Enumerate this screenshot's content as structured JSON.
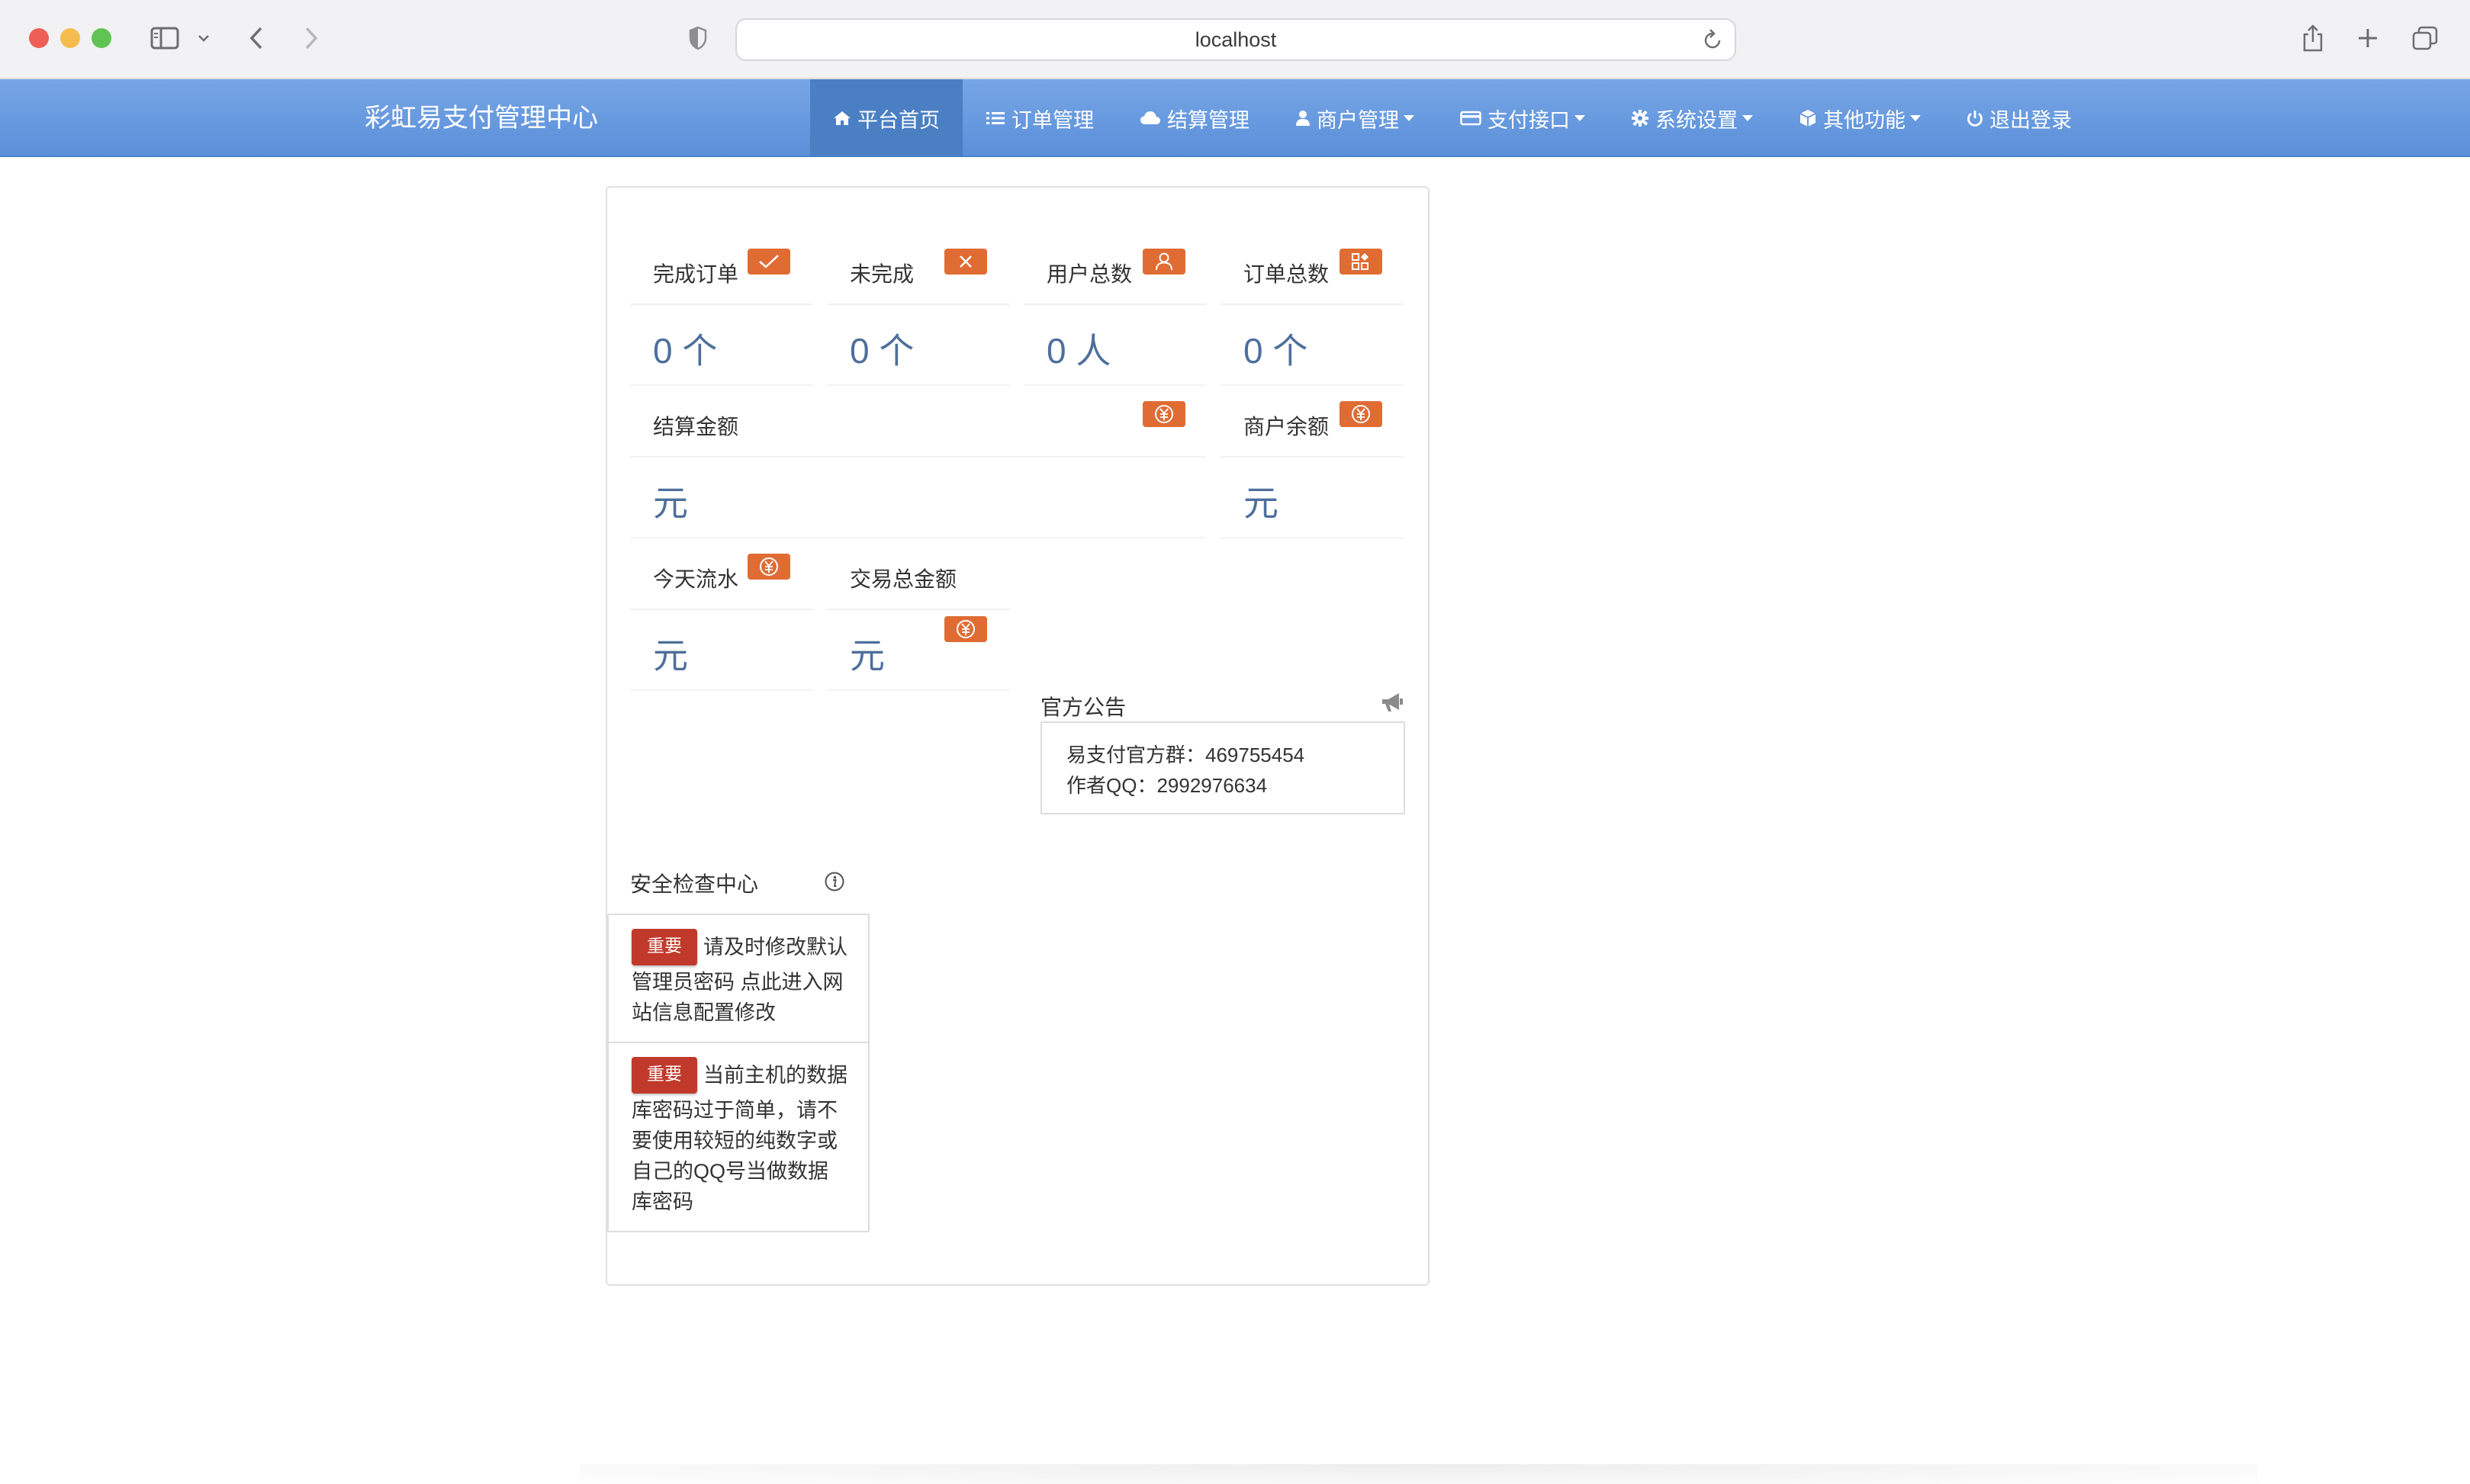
{
  "browser": {
    "url": "localhost"
  },
  "navbar": {
    "brand": "彩虹易支付管理中心",
    "items": [
      {
        "label": "平台首页",
        "icon": "home-icon",
        "dropdown": false,
        "active": true
      },
      {
        "label": "订单管理",
        "icon": "list-icon",
        "dropdown": false,
        "active": false
      },
      {
        "label": "结算管理",
        "icon": "cloud-icon",
        "dropdown": false,
        "active": false
      },
      {
        "label": "商户管理",
        "icon": "user-icon",
        "dropdown": true,
        "active": false
      },
      {
        "label": "支付接口",
        "icon": "credit-card-icon",
        "dropdown": true,
        "active": false
      },
      {
        "label": "系统设置",
        "icon": "gear-icon",
        "dropdown": true,
        "active": false
      },
      {
        "label": "其他功能",
        "icon": "cube-icon",
        "dropdown": true,
        "active": false
      },
      {
        "label": "退出登录",
        "icon": "power-icon",
        "dropdown": false,
        "active": false
      }
    ]
  },
  "stats": {
    "completed_orders": {
      "label": "完成订单",
      "value": "0 个",
      "icon": "check-icon"
    },
    "uncompleted": {
      "label": "未完成",
      "value": "0 个",
      "icon": "close-icon"
    },
    "total_users": {
      "label": "用户总数",
      "value": "0 人",
      "icon": "user-icon"
    },
    "total_orders": {
      "label": "订单总数",
      "value": "0 个",
      "icon": "apps-icon"
    },
    "settlement_amount": {
      "label": "结算金额",
      "value": "元",
      "icon": "yen-icon"
    },
    "merchant_balance": {
      "label": "商户余额",
      "value": "元",
      "icon": "yen-icon"
    },
    "today_flow": {
      "label": "今天流水",
      "value": "元",
      "icon": "yen-icon"
    },
    "trade_total": {
      "label": "交易总金额",
      "value": "元",
      "icon": "yen-icon"
    }
  },
  "notice": {
    "title": "官方公告",
    "icon": "megaphone-icon",
    "lines": [
      "易支付官方群：469755454",
      "作者QQ：2992976634"
    ]
  },
  "security": {
    "title": "安全检查中心",
    "icon": "info-icon",
    "items": [
      {
        "tag": "重要",
        "text": "请及时修改默认管理员密码 点此进入网站信息配置修改"
      },
      {
        "tag": "重要",
        "text": "当前主机的数据库密码过于简单，请不要使用较短的纯数字或自己的QQ号当做数据库密码"
      }
    ]
  },
  "colors": {
    "navbar": "#5a8fd9",
    "nav_active": "#4a7fc4",
    "badge": "#e06c34",
    "stat_value": "#4e6f9c",
    "tag": "#c0392b"
  }
}
